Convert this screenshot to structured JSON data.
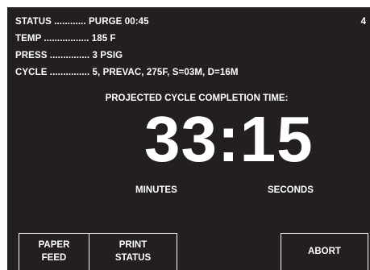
{
  "status_lines": {
    "status": {
      "label": "STATUS ............",
      "value": "PURGE 00:45"
    },
    "temp": {
      "label": "TEMP .................",
      "value": "185 F"
    },
    "press": {
      "label": "PRESS ...............",
      "value": "3 PSIG"
    },
    "cycle": {
      "label": "CYCLE ...............",
      "value": "5, PREVAC, 275F, S=03M, D=16M"
    }
  },
  "screen_number": "4",
  "projected": {
    "heading": "PROJECTED CYCLE COMPLETION TIME:",
    "time": "33:15",
    "minutes_label": "MINUTES",
    "seconds_label": "SECONDS"
  },
  "buttons": {
    "paper_feed": {
      "line1": "PAPER",
      "line2": "FEED"
    },
    "print_status": {
      "line1": "PRINT",
      "line2": "STATUS"
    },
    "abort": {
      "label": "ABORT"
    }
  },
  "colors": {
    "screen_background": "#231f20",
    "text": "#ffffff"
  }
}
